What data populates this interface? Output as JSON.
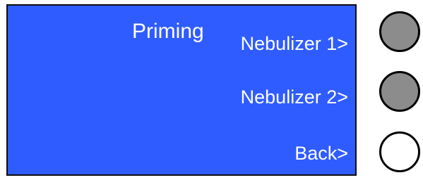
{
  "screen": {
    "title": "Priming",
    "background_color": "#2f5cff",
    "text_color": "#ffffff",
    "menu": [
      {
        "label": "Nebulizer 1>"
      },
      {
        "label": "Nebulizer 2>"
      },
      {
        "label": "Back>"
      }
    ]
  },
  "hardware_buttons": [
    {
      "state": "pressed",
      "color": "#8c8c8c"
    },
    {
      "state": "pressed",
      "color": "#8c8c8c"
    },
    {
      "state": "released",
      "color": "#ffffff"
    }
  ]
}
